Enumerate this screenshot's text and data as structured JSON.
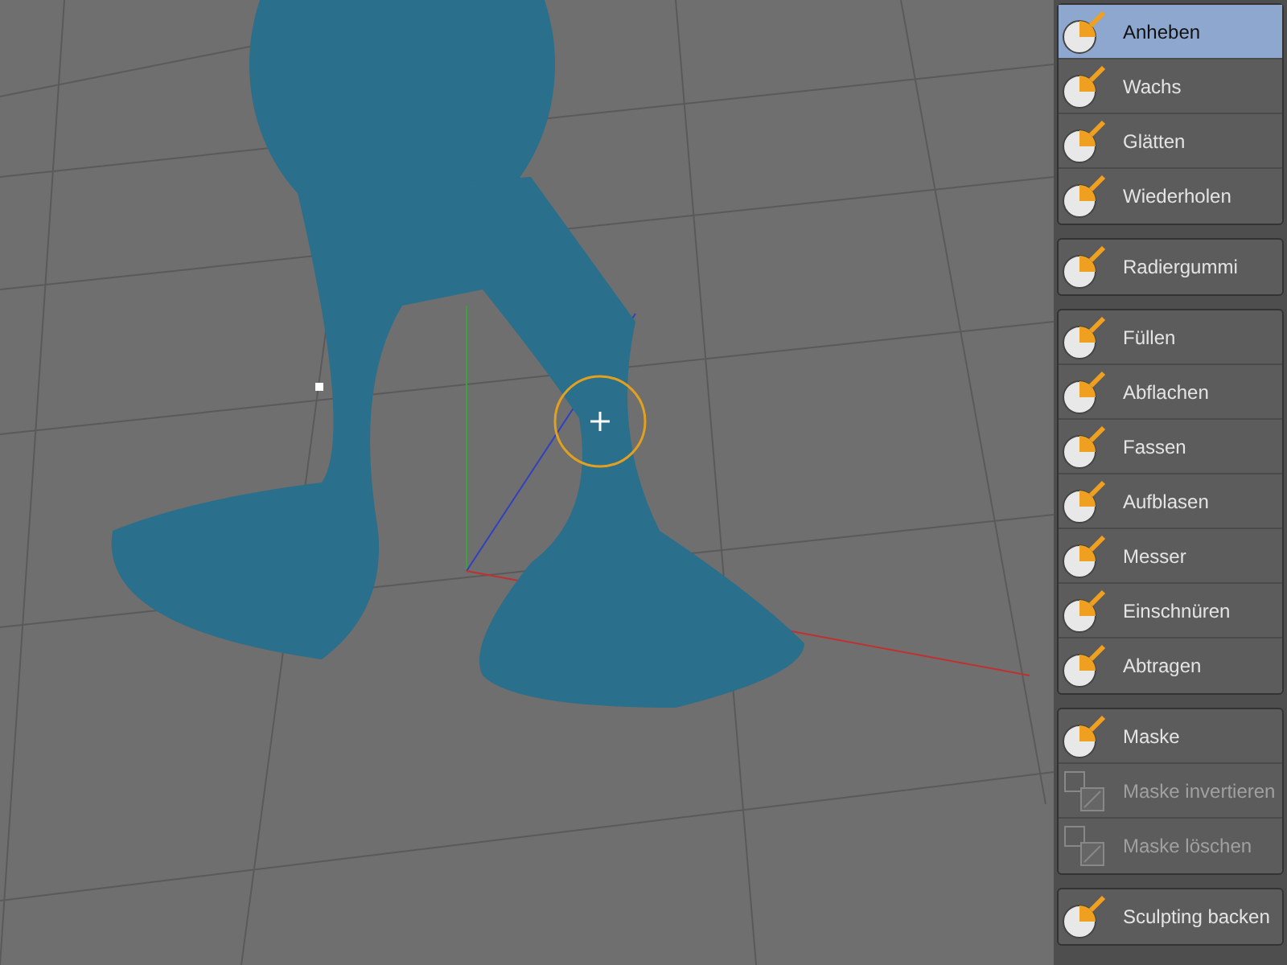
{
  "tool_panel": {
    "groups": [
      {
        "items": [
          {
            "label": "Anheben",
            "selected": true,
            "disabled": false
          },
          {
            "label": "Wachs",
            "selected": false,
            "disabled": false
          },
          {
            "label": "Glätten",
            "selected": false,
            "disabled": false
          },
          {
            "label": "Wiederholen",
            "selected": false,
            "disabled": false
          }
        ]
      },
      {
        "items": [
          {
            "label": "Radiergummi",
            "selected": false,
            "disabled": false
          }
        ]
      },
      {
        "items": [
          {
            "label": "Füllen",
            "selected": false,
            "disabled": false
          },
          {
            "label": "Abflachen",
            "selected": false,
            "disabled": false
          },
          {
            "label": "Fassen",
            "selected": false,
            "disabled": false
          },
          {
            "label": "Aufblasen",
            "selected": false,
            "disabled": false
          },
          {
            "label": "Messer",
            "selected": false,
            "disabled": false
          },
          {
            "label": "Einschnüren",
            "selected": false,
            "disabled": false
          },
          {
            "label": "Abtragen",
            "selected": false,
            "disabled": false
          }
        ]
      },
      {
        "items": [
          {
            "label": "Maske",
            "selected": false,
            "disabled": false
          },
          {
            "label": "Maske invertieren",
            "selected": false,
            "disabled": true
          },
          {
            "label": "Maske löschen",
            "selected": false,
            "disabled": true
          }
        ]
      },
      {
        "items": [
          {
            "label": "Sculpting backen",
            "selected": false,
            "disabled": false
          }
        ]
      }
    ]
  }
}
